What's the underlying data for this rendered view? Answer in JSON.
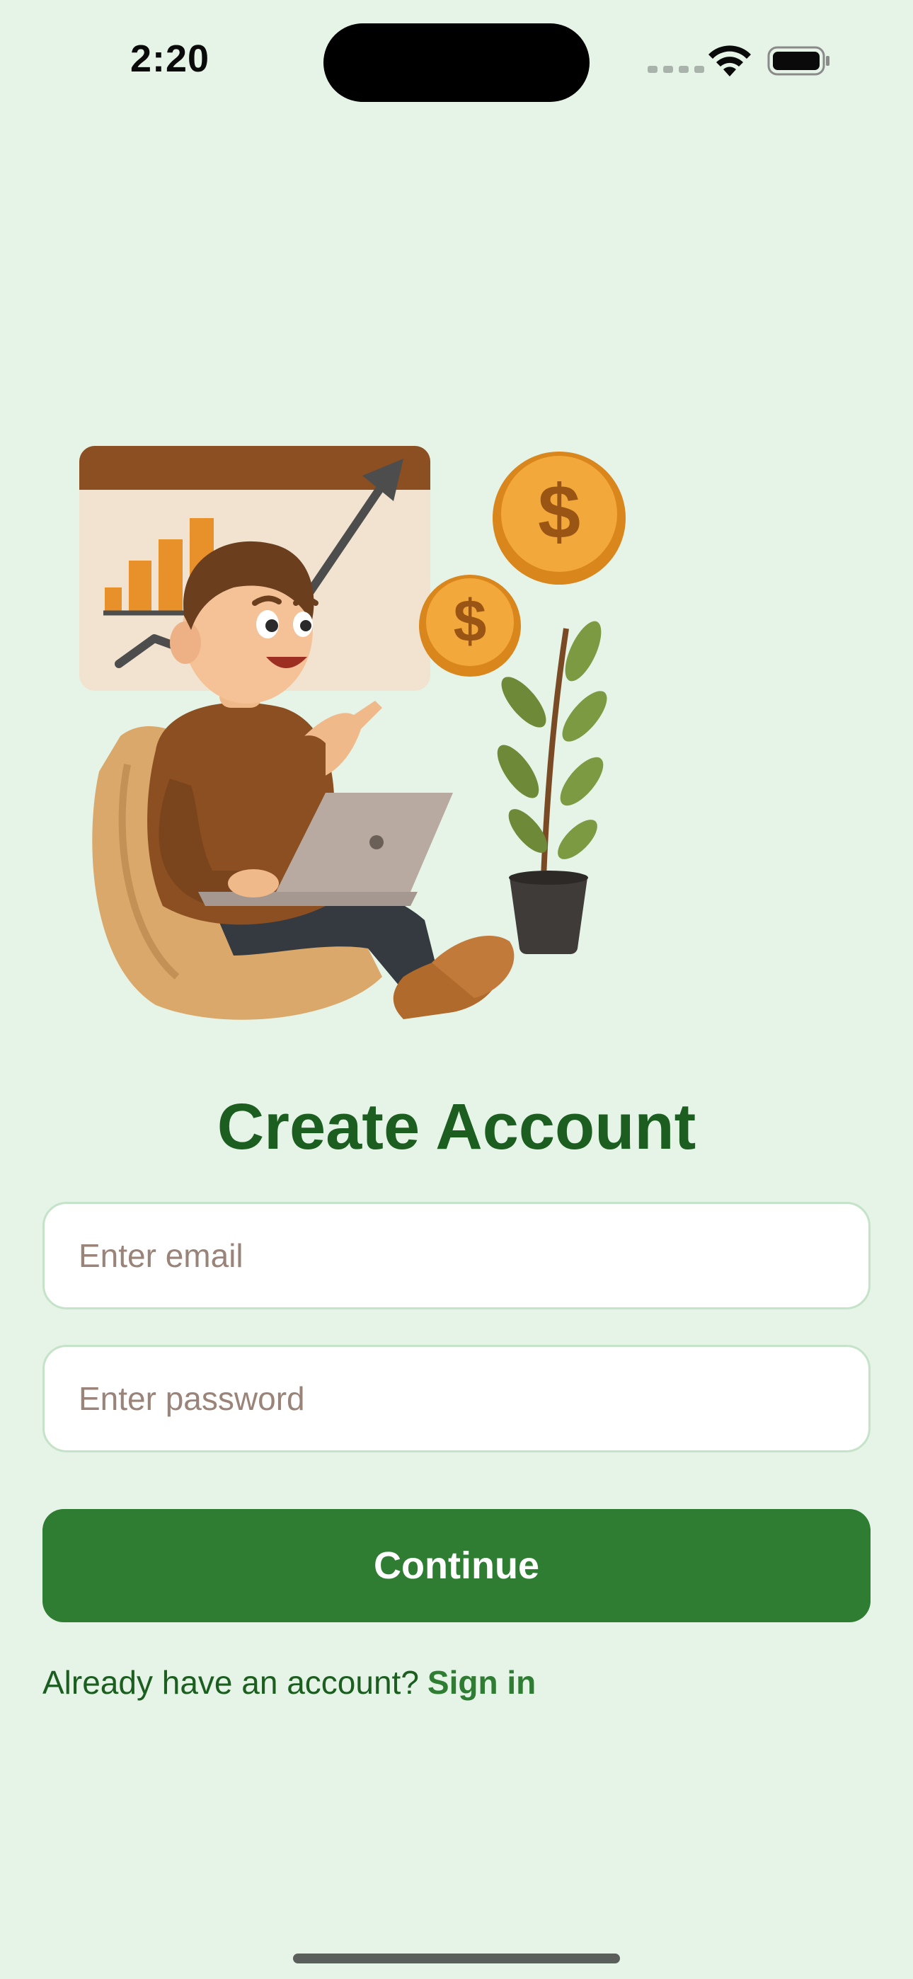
{
  "status_bar": {
    "time": "2:20"
  },
  "colors": {
    "background": "#e6f4e8",
    "primary": "#2e7d32",
    "title": "#1b5e20",
    "placeholder": "#9a8378"
  },
  "illustration": {
    "icon": "man-on-beanbag-with-laptop-growth-chart-coins-plant",
    "coin_symbol": "$"
  },
  "form": {
    "title": "Create Account",
    "email_placeholder": "Enter email",
    "password_placeholder": "Enter password",
    "continue_label": "Continue"
  },
  "footer": {
    "prompt": "Already have an account?",
    "signin_label": "Sign in"
  }
}
